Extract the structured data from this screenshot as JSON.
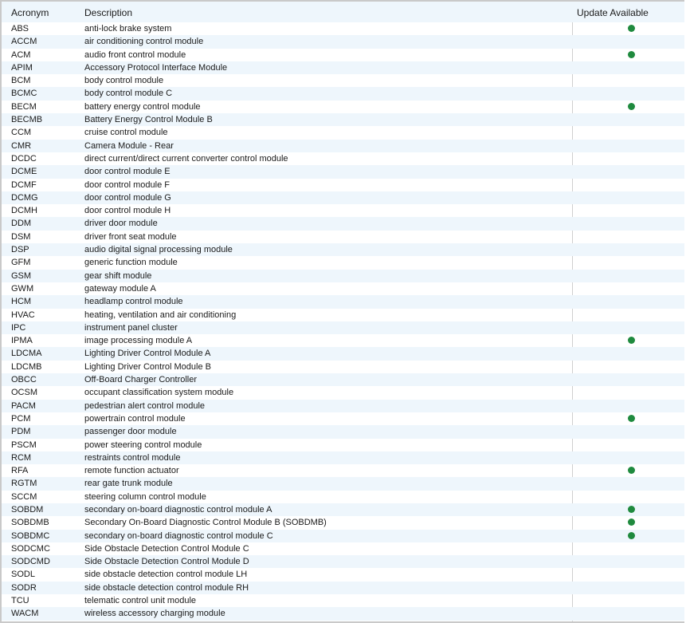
{
  "table": {
    "columns": [
      "Acronym",
      "Description",
      "Update Available"
    ],
    "rows": [
      {
        "acronym": "ABS",
        "description": "anti-lock brake system",
        "update": true
      },
      {
        "acronym": "ACCM",
        "description": "air conditioning control module",
        "update": false
      },
      {
        "acronym": "ACM",
        "description": "audio front control module",
        "update": true
      },
      {
        "acronym": "APIM",
        "description": "Accessory Protocol Interface Module",
        "update": false
      },
      {
        "acronym": "BCM",
        "description": "body control module",
        "update": false
      },
      {
        "acronym": "BCMC",
        "description": "body control module C",
        "update": false
      },
      {
        "acronym": "BECM",
        "description": "battery energy control module",
        "update": true
      },
      {
        "acronym": "BECMB",
        "description": "Battery Energy Control Module B",
        "update": false
      },
      {
        "acronym": "CCM",
        "description": "cruise control module",
        "update": false
      },
      {
        "acronym": "CMR",
        "description": "Camera Module - Rear",
        "update": false
      },
      {
        "acronym": "DCDC",
        "description": "direct current/direct current converter control module",
        "update": false
      },
      {
        "acronym": "DCME",
        "description": "door control module E",
        "update": false
      },
      {
        "acronym": "DCMF",
        "description": "door control module F",
        "update": false
      },
      {
        "acronym": "DCMG",
        "description": "door control module G",
        "update": false
      },
      {
        "acronym": "DCMH",
        "description": "door control module H",
        "update": false
      },
      {
        "acronym": "DDM",
        "description": "driver door module",
        "update": false
      },
      {
        "acronym": "DSM",
        "description": "driver front seat module",
        "update": false
      },
      {
        "acronym": "DSP",
        "description": "audio digital signal processing module",
        "update": false
      },
      {
        "acronym": "GFM",
        "description": "generic function module",
        "update": false
      },
      {
        "acronym": "GSM",
        "description": "gear shift module",
        "update": false
      },
      {
        "acronym": "GWM",
        "description": "gateway module A",
        "update": false
      },
      {
        "acronym": "HCM",
        "description": "headlamp control module",
        "update": false
      },
      {
        "acronym": "HVAC",
        "description": "heating, ventilation and air conditioning",
        "update": false
      },
      {
        "acronym": "IPC",
        "description": "instrument panel cluster",
        "update": false
      },
      {
        "acronym": "IPMA",
        "description": "image processing module A",
        "update": true
      },
      {
        "acronym": "LDCMA",
        "description": "Lighting Driver Control Module A",
        "update": false
      },
      {
        "acronym": "LDCMB",
        "description": "Lighting Driver Control Module B",
        "update": false
      },
      {
        "acronym": "OBCC",
        "description": "Off-Board Charger Controller",
        "update": false
      },
      {
        "acronym": "OCSM",
        "description": "occupant classification system module",
        "update": false
      },
      {
        "acronym": "PACM",
        "description": "pedestrian alert control module",
        "update": false
      },
      {
        "acronym": "PCM",
        "description": "powertrain control module",
        "update": true
      },
      {
        "acronym": "PDM",
        "description": "passenger door module",
        "update": false
      },
      {
        "acronym": "PSCM",
        "description": "power steering control module",
        "update": false
      },
      {
        "acronym": "RCM",
        "description": "restraints control module",
        "update": false
      },
      {
        "acronym": "RFA",
        "description": "remote function actuator",
        "update": true
      },
      {
        "acronym": "RGTM",
        "description": "rear gate trunk module",
        "update": false
      },
      {
        "acronym": "SCCM",
        "description": "steering column control module",
        "update": false
      },
      {
        "acronym": "SOBDM",
        "description": "secondary on-board diagnostic control module A",
        "update": true
      },
      {
        "acronym": "SOBDMB",
        "description": "Secondary On-Board Diagnostic Control Module B (SOBDMB)",
        "update": true
      },
      {
        "acronym": "SOBDMC",
        "description": "secondary on-board diagnostic control module C",
        "update": true
      },
      {
        "acronym": "SODCMC",
        "description": "Side Obstacle Detection Control Module C",
        "update": false
      },
      {
        "acronym": "SODCMD",
        "description": "Side Obstacle Detection Control Module D",
        "update": false
      },
      {
        "acronym": "SODL",
        "description": "side obstacle detection control module LH",
        "update": false
      },
      {
        "acronym": "SODR",
        "description": "side obstacle detection control module RH",
        "update": false
      },
      {
        "acronym": "TCU",
        "description": "telematic control unit module",
        "update": false
      },
      {
        "acronym": "WACM",
        "description": "wireless accessory charging module",
        "update": false
      }
    ]
  },
  "colors": {
    "update_dot": "#1f8a3e",
    "stripe": "#eef6fc"
  },
  "icons": {
    "update_indicator": "green-dot-icon"
  }
}
